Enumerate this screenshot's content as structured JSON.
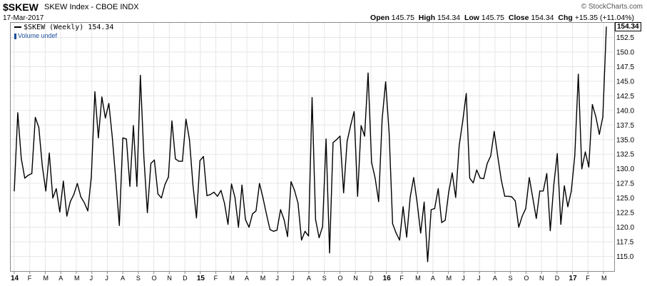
{
  "header": {
    "symbol": "$SKEW",
    "name": "SKEW Index - CBOE  INDX",
    "date": "17-Mar-2017",
    "brand": "© StockCharts.com",
    "quote": {
      "open_label": "Open",
      "open": "145.75",
      "high_label": "High",
      "high": "154.34",
      "low_label": "Low",
      "low": "145.75",
      "close_label": "Close",
      "close": "154.34",
      "chg_label": "Chg",
      "chg": "+15.35 (+11.04%)"
    }
  },
  "legend": {
    "series_label": "$SKEW (Weekly) 154.34",
    "volume_label": "Volume undef"
  },
  "last_value_label": "154.34",
  "colors": {
    "line": "#000000",
    "grid": "#e6e6e6",
    "frame": "#8a8a8a",
    "volume": "#1b4f9c"
  },
  "chart_data": {
    "type": "line",
    "series": [
      {
        "name": "$SKEW (Weekly)",
        "values": [
          126.2,
          139.6,
          131.8,
          128.4,
          128.9,
          129.2,
          138.8,
          137.1,
          130.5,
          126.2,
          132.7,
          125.0,
          126.6,
          122.6,
          127.9,
          121.9,
          124.4,
          125.6,
          127.5,
          125.2,
          124.2,
          122.8,
          128.6,
          143.2,
          135.3,
          142.3,
          138.7,
          141.2,
          135.3,
          128.0,
          120.3,
          135.3,
          135.1,
          127.0,
          137.4,
          127.0,
          146.0,
          132.0,
          122.5,
          130.9,
          131.5,
          125.7,
          125.0,
          127.3,
          128.6,
          138.2,
          131.7,
          131.3,
          131.3,
          138.5,
          135.0,
          127.2,
          121.6,
          131.4,
          132.1,
          125.4,
          125.6,
          126.0,
          125.3,
          126.3,
          124.1,
          120.5,
          127.4,
          125.1,
          120.0,
          127.2,
          121.3,
          120.0,
          122.3,
          122.8,
          127.5,
          125.0,
          122.2,
          119.6,
          119.3,
          119.5,
          123.0,
          121.3,
          118.4,
          127.8,
          126.3,
          124.1,
          117.8,
          119.3,
          118.5,
          142.2,
          121.3,
          118.2,
          120.1,
          135.1,
          115.6,
          134.5,
          135.0,
          135.6,
          125.9,
          134.7,
          137.4,
          139.8,
          125.3,
          137.4,
          135.6,
          146.4,
          131.1,
          128.4,
          124.4,
          138.5,
          144.9,
          136.2,
          120.6,
          119.0,
          117.8,
          123.5,
          118.3,
          125.1,
          128.5,
          124.2,
          119.0,
          124.3,
          114.1,
          123.0,
          123.2,
          126.6,
          120.8,
          121.2,
          126.0,
          129.3,
          125.1,
          134.0,
          138.1,
          142.9,
          128.4,
          127.6,
          129.8,
          128.4,
          128.3,
          130.9,
          132.2,
          136.4,
          132.1,
          128.1,
          125.3,
          125.3,
          125.2,
          124.5,
          120.0,
          121.9,
          123.2,
          128.5,
          125.0,
          121.5,
          126.2,
          126.2,
          129.2,
          119.4,
          127.2,
          132.6,
          120.5,
          127.1,
          123.5,
          126.2,
          132.3,
          146.2,
          130.0,
          132.9,
          130.3,
          141.0,
          138.9,
          135.9,
          138.9,
          154.3
        ]
      }
    ],
    "x_tick_labels": [
      "14",
      "F",
      "M",
      "A",
      "M",
      "J",
      "J",
      "A",
      "S",
      "O",
      "N",
      "D",
      "15",
      "F",
      "M",
      "A",
      "M",
      "J",
      "J",
      "A",
      "S",
      "O",
      "N",
      "D",
      "16",
      "F",
      "M",
      "A",
      "M",
      "J",
      "J",
      "A",
      "S",
      "O",
      "N",
      "D",
      "17",
      "F",
      "M"
    ],
    "y_ticks": [
      115.0,
      117.5,
      120.0,
      122.5,
      125.0,
      127.5,
      130.0,
      132.5,
      135.0,
      137.5,
      140.0,
      142.5,
      145.0,
      147.5,
      150.0,
      152.5
    ],
    "ylim": [
      112.5,
      155.0
    ],
    "grid": true,
    "title": "$SKEW",
    "xlabel": "",
    "ylabel": ""
  }
}
